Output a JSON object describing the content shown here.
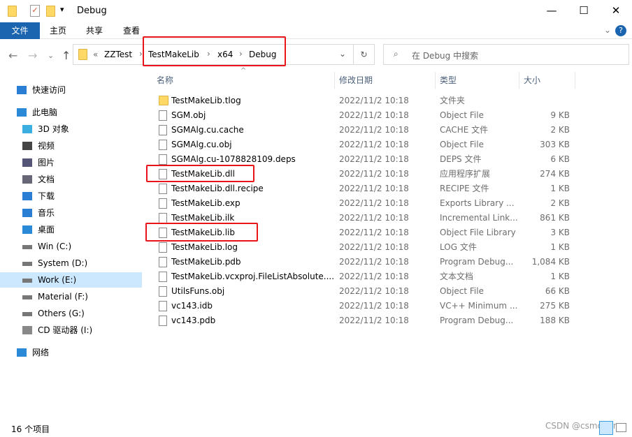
{
  "window": {
    "title": "Debug"
  },
  "ribbon": {
    "tabs": [
      "文件",
      "主页",
      "共享",
      "查看"
    ]
  },
  "address": {
    "overflow": "«",
    "crumbs": [
      "ZZTest",
      "TestMakeLib",
      "x64",
      "Debug"
    ]
  },
  "search": {
    "placeholder": "在 Debug 中搜索"
  },
  "sidebar": {
    "items": [
      {
        "label": "快速访问",
        "icon": "star-icon"
      },
      {
        "label": "此电脑",
        "icon": "computer-icon"
      },
      {
        "label": "3D 对象",
        "icon": "cube-icon"
      },
      {
        "label": "视频",
        "icon": "video-icon"
      },
      {
        "label": "图片",
        "icon": "picture-icon"
      },
      {
        "label": "文档",
        "icon": "document-icon"
      },
      {
        "label": "下载",
        "icon": "download-icon"
      },
      {
        "label": "音乐",
        "icon": "music-icon"
      },
      {
        "label": "桌面",
        "icon": "desktop-icon"
      },
      {
        "label": "Win (C:)",
        "icon": "drive-icon"
      },
      {
        "label": "System (D:)",
        "icon": "drive-icon"
      },
      {
        "label": "Work (E:)",
        "icon": "drive-icon",
        "selected": true
      },
      {
        "label": "Material (F:)",
        "icon": "drive-icon"
      },
      {
        "label": "Others (G:)",
        "icon": "drive-icon"
      },
      {
        "label": "CD 驱动器 (I:)",
        "icon": "cd-drive-icon"
      },
      {
        "label": "网络",
        "icon": "network-icon"
      }
    ]
  },
  "columns": {
    "name": "名称",
    "date": "修改日期",
    "type": "类型",
    "size": "大小"
  },
  "files": [
    {
      "name": "TestMakeLib.tlog",
      "date": "2022/11/2 10:18",
      "type": "文件夹",
      "size": "",
      "folder": true
    },
    {
      "name": "SGM.obj",
      "date": "2022/11/2 10:18",
      "type": "Object File",
      "size": "9 KB"
    },
    {
      "name": "SGMAlg.cu.cache",
      "date": "2022/11/2 10:18",
      "type": "CACHE 文件",
      "size": "2 KB"
    },
    {
      "name": "SGMAlg.cu.obj",
      "date": "2022/11/2 10:18",
      "type": "Object File",
      "size": "303 KB"
    },
    {
      "name": "SGMAlg.cu-1078828109.deps",
      "date": "2022/11/2 10:18",
      "type": "DEPS 文件",
      "size": "6 KB"
    },
    {
      "name": "TestMakeLib.dll",
      "date": "2022/11/2 10:18",
      "type": "应用程序扩展",
      "size": "274 KB"
    },
    {
      "name": "TestMakeLib.dll.recipe",
      "date": "2022/11/2 10:18",
      "type": "RECIPE 文件",
      "size": "1 KB"
    },
    {
      "name": "TestMakeLib.exp",
      "date": "2022/11/2 10:18",
      "type": "Exports Library ...",
      "size": "2 KB"
    },
    {
      "name": "TestMakeLib.ilk",
      "date": "2022/11/2 10:18",
      "type": "Incremental Link...",
      "size": "861 KB"
    },
    {
      "name": "TestMakeLib.lib",
      "date": "2022/11/2 10:18",
      "type": "Object File Library",
      "size": "3 KB"
    },
    {
      "name": "TestMakeLib.log",
      "date": "2022/11/2 10:18",
      "type": "LOG 文件",
      "size": "1 KB"
    },
    {
      "name": "TestMakeLib.pdb",
      "date": "2022/11/2 10:18",
      "type": "Program Debug...",
      "size": "1,084 KB"
    },
    {
      "name": "TestMakeLib.vcxproj.FileListAbsolute....",
      "date": "2022/11/2 10:18",
      "type": "文本文档",
      "size": "1 KB"
    },
    {
      "name": "UtilsFuns.obj",
      "date": "2022/11/2 10:18",
      "type": "Object File",
      "size": "66 KB"
    },
    {
      "name": "vc143.idb",
      "date": "2022/11/2 10:18",
      "type": "VC++ Minimum ...",
      "size": "275 KB"
    },
    {
      "name": "vc143.pdb",
      "date": "2022/11/2 10:18",
      "type": "Program Debug...",
      "size": "188 KB"
    }
  ],
  "status": {
    "count": "16 个项目"
  },
  "watermark": "CSDN @csmoner"
}
